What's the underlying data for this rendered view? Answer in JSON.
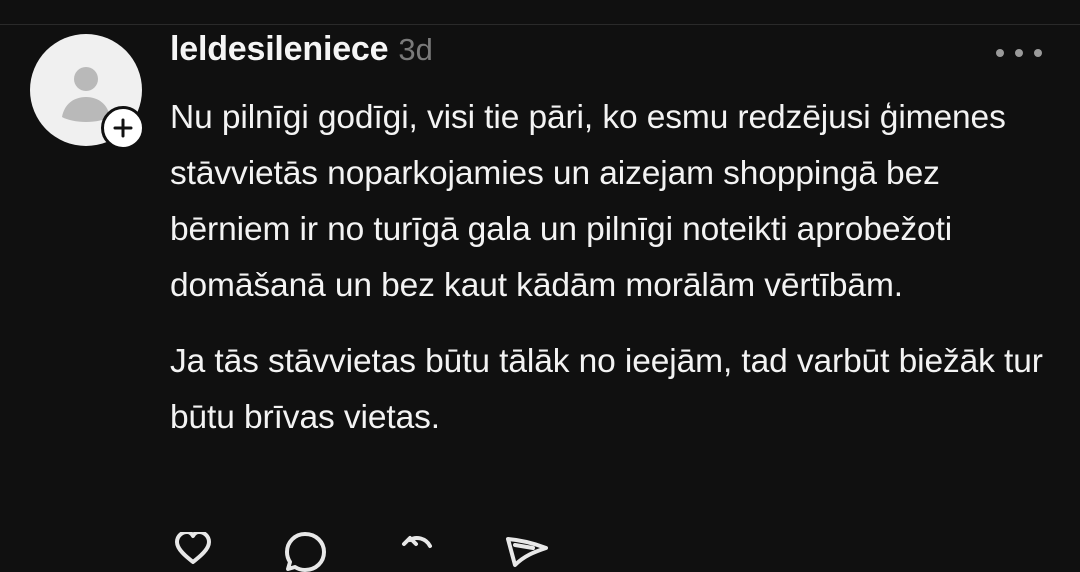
{
  "comment": {
    "username": "leldesileniece",
    "timestamp": "3d",
    "paragraphs": [
      "Nu pilnīgi godīgi, visi tie pāri, ko esmu redzējusi ģimenes stāvvietās noparkojamies un aizejam shoppingā bez bērniem ir no turīgā gala un pilnīgi noteikti aprobežoti domāšanā un bez kaut kādām morālām vērtībām.",
      "Ja tās stāvvietas būtu tālāk no ieejām, tad varbūt biežāk tur būtu brīvas vietas."
    ]
  },
  "icons": {
    "avatar": "default-user-avatar-icon",
    "follow": "plus-icon",
    "more": "more-horizontal-icon",
    "like": "heart-icon",
    "reply": "comment-bubble-icon",
    "repost": "repost-icon",
    "share": "send-icon"
  },
  "colors": {
    "background": "#101010",
    "text": "#f3f3f3",
    "muted": "#7a7a7a",
    "avatar": "#f0f0f0"
  }
}
